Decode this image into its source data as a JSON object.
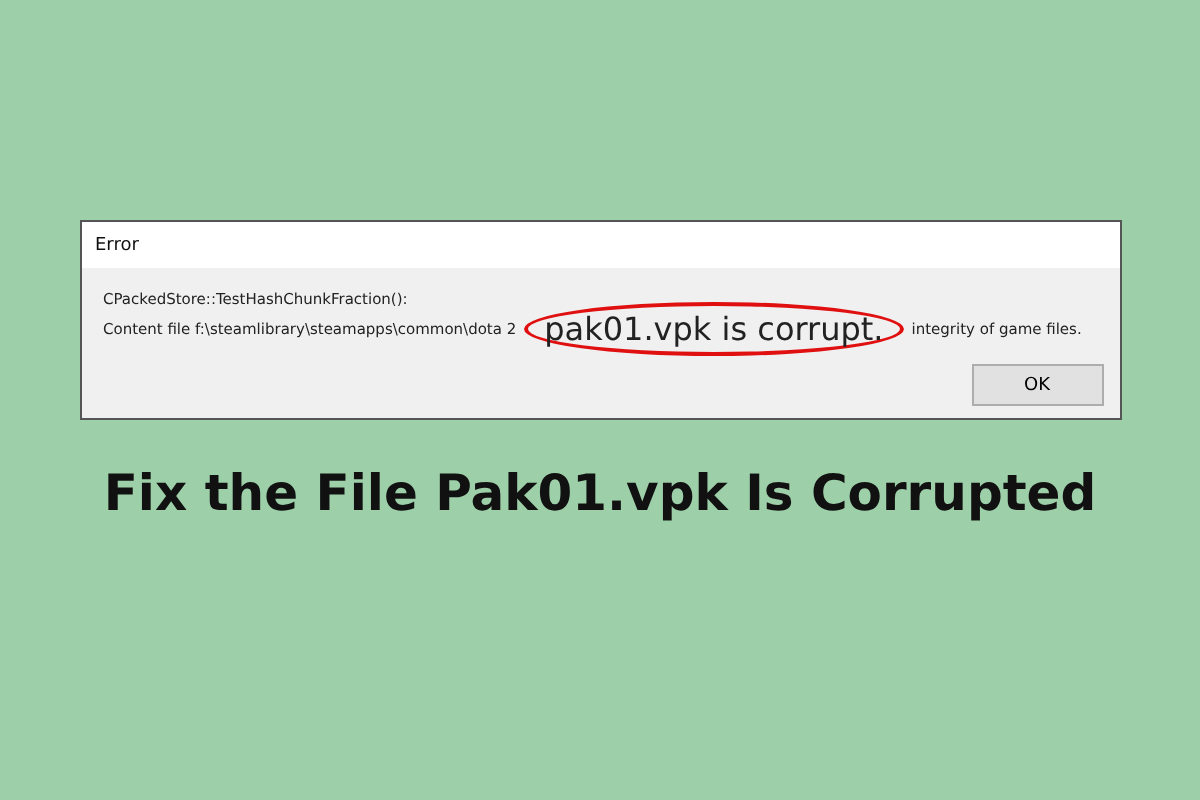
{
  "dialog": {
    "title": "Error",
    "message_line_1": "CPackedStore::TestHashChunkFraction():",
    "message_line_2_start": "Content file f:\\steamlibrary\\steamapps\\common\\dota 2",
    "highlighted_text": "pak01.vpk is corrupt.",
    "message_line_2_end": "integrity of game files.",
    "buttons": [
      "OK"
    ]
  },
  "headline": "Fix the File Pak01.vpk Is Corrupted"
}
